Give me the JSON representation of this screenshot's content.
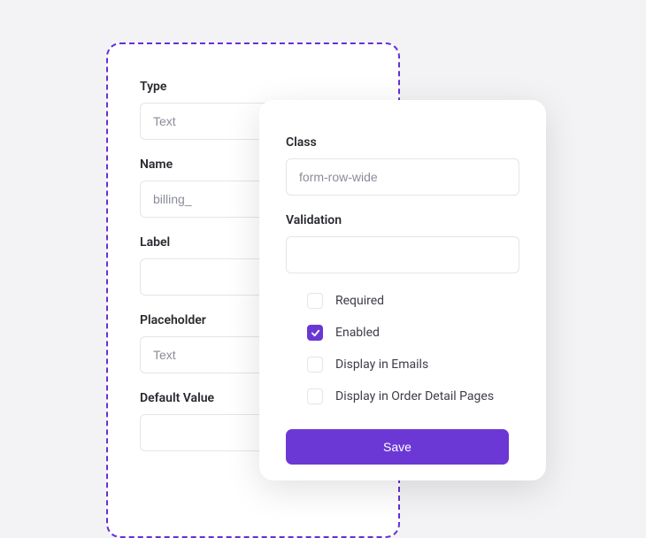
{
  "backPanel": {
    "type": {
      "label": "Type",
      "value": "Text"
    },
    "name": {
      "label": "Name",
      "value": "billing_"
    },
    "labelField": {
      "label": "Label",
      "value": ""
    },
    "placeholder": {
      "label": "Placeholder",
      "value": "Text"
    },
    "defaultValue": {
      "label": "Default Value",
      "value": ""
    }
  },
  "frontPanel": {
    "class": {
      "label": "Class",
      "value": "form-row-wide"
    },
    "validation": {
      "label": "Validation",
      "value": ""
    },
    "checkboxes": {
      "required": {
        "label": "Required",
        "checked": false
      },
      "enabled": {
        "label": "Enabled",
        "checked": true
      },
      "displayInEmails": {
        "label": "Display in Emails",
        "checked": false
      },
      "displayInOrderDetail": {
        "label": "Display in Order Detail Pages",
        "checked": false
      }
    },
    "saveLabel": "Save"
  }
}
